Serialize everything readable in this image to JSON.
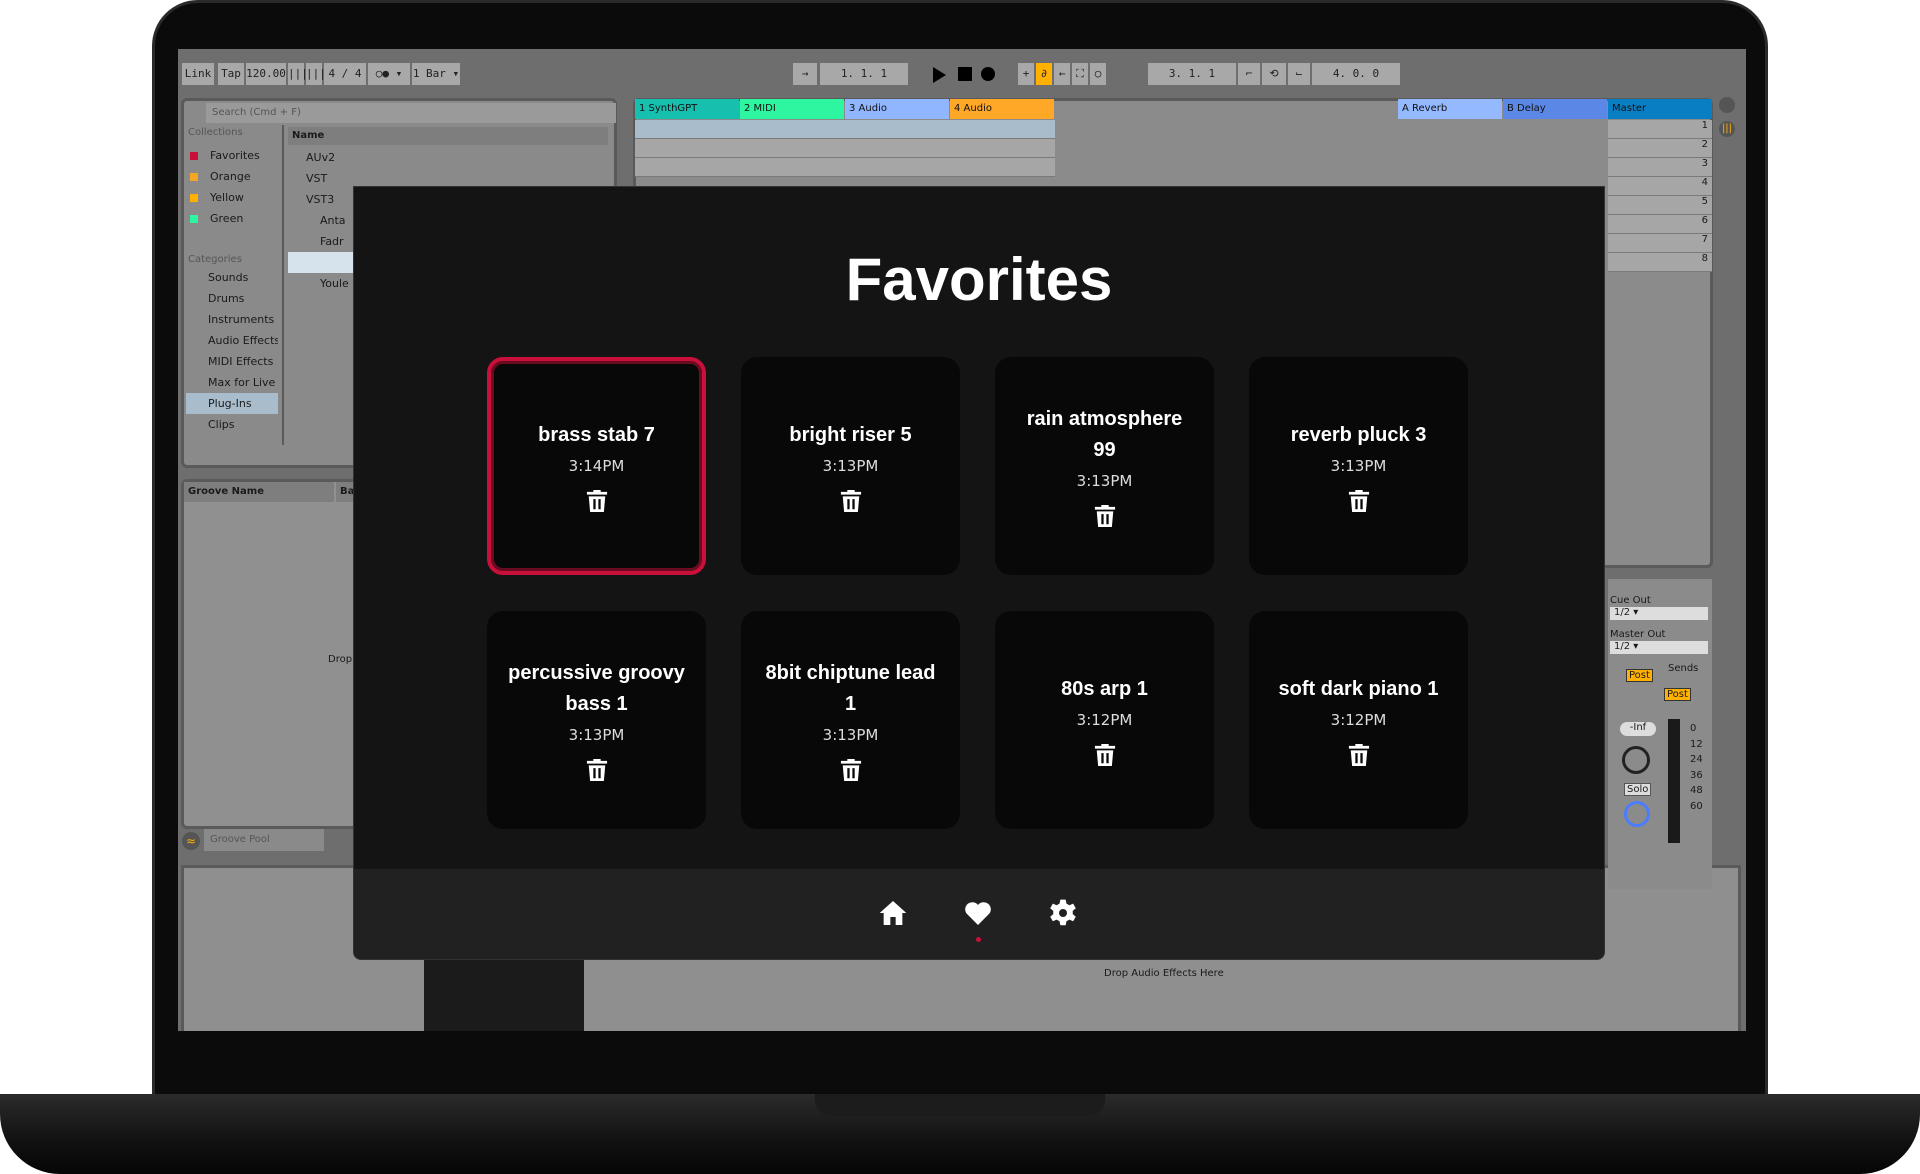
{
  "daw": {
    "toolbar": {
      "link": "Link",
      "tap": "Tap",
      "tempo": "120.00",
      "signature": "4 / 4",
      "quantize": "1 Bar",
      "position": "1.  1.  1",
      "loop_start": "3.  1.  1",
      "loop_length": "4.  0.  0"
    },
    "browser": {
      "search_placeholder": "Search (Cmd + F)",
      "collections_label": "Collections",
      "collections": [
        {
          "label": "Favorites",
          "color": "#c8103a"
        },
        {
          "label": "Orange",
          "color": "#f5a623"
        },
        {
          "label": "Yellow",
          "color": "#ffb000"
        },
        {
          "label": "Green",
          "color": "#2ef5a0"
        }
      ],
      "categories_label": "Categories",
      "categories": [
        "Sounds",
        "Drums",
        "Instruments",
        "Audio Effects",
        "MIDI Effects",
        "Max for Live",
        "Plug-Ins",
        "Clips"
      ],
      "selected_category": "Plug-Ins",
      "name_header": "Name",
      "tree": [
        "AUv2",
        "VST",
        "VST3",
        "Anta",
        "Fadr",
        "",
        "Youle"
      ]
    },
    "groove": {
      "name_header": "Groove Name",
      "base_header": "Bas",
      "drop_text": "Drop",
      "pool_label": "Groove Pool"
    },
    "tracks": [
      {
        "name": "1 SynthGPT",
        "color": "#17bfae"
      },
      {
        "name": "2 MIDI",
        "color": "#2ef5a0"
      },
      {
        "name": "3 Audio",
        "color": "#8fb6ff"
      },
      {
        "name": "4 Audio",
        "color": "#ffa726"
      }
    ],
    "returns": [
      {
        "name": "A Reverb",
        "color": "#95b9ff"
      },
      {
        "name": "B Delay",
        "color": "#5b87e6"
      }
    ],
    "master": {
      "name": "Master",
      "color": "#0a7ec2",
      "scenes": [
        "1",
        "2",
        "3",
        "4",
        "5",
        "6",
        "7",
        "8"
      ]
    },
    "mixer": {
      "cue_out_label": "Cue Out",
      "cue_out_value": "1/2",
      "master_out_label": "Master Out",
      "master_out_value": "1/2",
      "sends_label": "Sends",
      "post_label": "Post",
      "volume": "-Inf",
      "solo_label": "Solo",
      "meter_ticks": [
        "0",
        "12",
        "24",
        "36",
        "48",
        "60"
      ]
    },
    "drop_effects": "Drop Audio Effects Here"
  },
  "favorites": {
    "title": "Favorites",
    "accent": "#c8103a",
    "items": [
      {
        "name": "brass stab 7",
        "time": "3:14PM",
        "selected": true
      },
      {
        "name": "bright riser 5",
        "time": "3:13PM"
      },
      {
        "name": "rain atmosphere 99",
        "time": "3:13PM"
      },
      {
        "name": "reverb pluck 3",
        "time": "3:13PM"
      },
      {
        "name": "percussive groovy bass 1",
        "time": "3:13PM"
      },
      {
        "name": "8bit chiptune lead 1",
        "time": "3:13PM"
      },
      {
        "name": "80s arp 1",
        "time": "3:12PM"
      },
      {
        "name": "soft dark piano 1",
        "time": "3:12PM"
      }
    ],
    "nav": [
      {
        "icon": "home-icon"
      },
      {
        "icon": "heart-icon",
        "active": true
      },
      {
        "icon": "gear-icon"
      }
    ]
  }
}
